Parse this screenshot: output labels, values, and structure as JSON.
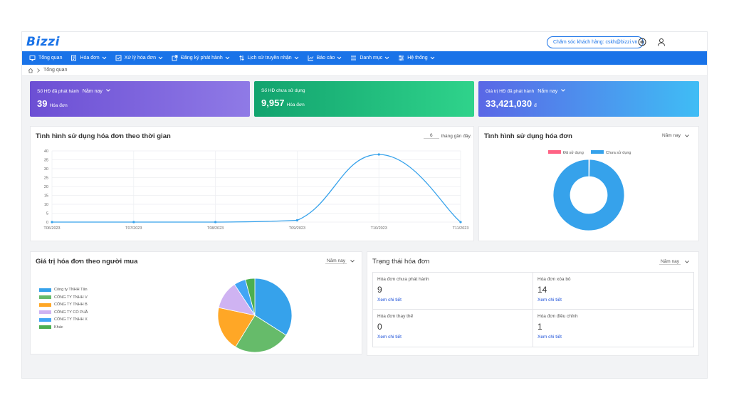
{
  "app": {
    "logo": "Bizzi",
    "support": "Chăm sóc khách hàng: cskh@bizzi.vn"
  },
  "nav": [
    {
      "label": "Tổng quan",
      "icon": "monitor-icon",
      "has_menu": false
    },
    {
      "label": "Hóa đơn",
      "icon": "invoice-icon",
      "has_menu": true
    },
    {
      "label": "Xử lý hóa đơn",
      "icon": "checkbox-icon",
      "has_menu": true
    },
    {
      "label": "Đăng ký phát hành",
      "icon": "external-link-icon",
      "has_menu": true
    },
    {
      "label": "Lịch sử truyền nhận",
      "icon": "transfer-icon",
      "has_menu": true
    },
    {
      "label": "Báo cáo",
      "icon": "chart-icon",
      "has_menu": true
    },
    {
      "label": "Danh mục",
      "icon": "list-icon",
      "has_menu": true
    },
    {
      "label": "Hệ thống",
      "icon": "settings-icon",
      "has_menu": true
    }
  ],
  "breadcrumb": {
    "current": "Tổng quan"
  },
  "stats": [
    {
      "label": "Số HĐ đã phát hành",
      "period": "Năm nay",
      "value": "39",
      "unit": "Hóa đơn",
      "colors": [
        "#6c4fd4",
        "#8f7ae6"
      ]
    },
    {
      "label": "Số HĐ chưa sử dụng",
      "period": "",
      "value": "9,957",
      "unit": "Hóa đơn",
      "colors": [
        "#12a36e",
        "#2fd38b"
      ]
    },
    {
      "label": "Giá trị HĐ đã phát hành",
      "period": "Năm nay",
      "value": "33,421,030",
      "unit": "đ",
      "colors": [
        "#5a67e6",
        "#3fbdf5"
      ]
    }
  ],
  "usage_time": {
    "title": "Tình hình sử dụng hóa đơn theo thời gian",
    "months_value": "6",
    "months_suffix": "tháng gần đây."
  },
  "usage": {
    "title": "Tình hình sử dụng hóa đơn",
    "period": "Năm nay"
  },
  "buyer": {
    "title": "Giá trị hóa đơn theo người mua",
    "period": "Năm nay"
  },
  "status": {
    "title": "Trạng thái hóa đơn",
    "period": "Năm nay",
    "link_label": "Xem chi tiết",
    "cells": [
      {
        "label": "Hóa đơn chưa phát hành",
        "value": "9"
      },
      {
        "label": "Hóa đơn xóa bỏ",
        "value": "14"
      },
      {
        "label": "Hóa đơn thay thế",
        "value": "0"
      },
      {
        "label": "Hóa đơn điều chỉnh",
        "value": "1"
      }
    ]
  },
  "chart_data": [
    {
      "type": "line",
      "title": "Tình hình sử dụng hóa đơn theo thời gian",
      "categories": [
        "T06/2023",
        "T07/2023",
        "T08/2023",
        "T09/2023",
        "T10/2023",
        "T11/2023"
      ],
      "values": [
        0,
        0,
        0,
        1,
        38,
        0
      ],
      "ylim": [
        0,
        40
      ],
      "yticks": [
        0,
        5,
        10,
        15,
        20,
        25,
        30,
        35,
        40
      ],
      "grid": true,
      "color": "#36a2eb"
    },
    {
      "type": "pie",
      "donut": true,
      "title": "Tình hình sử dụng hóa đơn",
      "legend_position": "top",
      "series": [
        {
          "name": "Đã sử dụng",
          "value": 39,
          "color": "#ff6384"
        },
        {
          "name": "Chưa sử dụng",
          "value": 9957,
          "color": "#36a2eb"
        }
      ]
    },
    {
      "type": "pie",
      "title": "Giá trị hóa đơn theo người mua",
      "legend_position": "left",
      "series": [
        {
          "name": "Công ty TNHH Tân",
          "value": 33,
          "color": "#36a2eb"
        },
        {
          "name": "CÔNG TY TNHH V",
          "value": 24,
          "color": "#66bb6a"
        },
        {
          "name": "CÔNG TY TNHH B",
          "value": 19,
          "color": "#ffa726"
        },
        {
          "name": "CÔNG TY CỔ PHẦ",
          "value": 12,
          "color": "#cfb3f2"
        },
        {
          "name": "CÔNG TY TNHH X",
          "value": 5,
          "color": "#42a5f5"
        },
        {
          "name": "Khác",
          "value": 4,
          "color": "#4caf50"
        }
      ]
    }
  ]
}
